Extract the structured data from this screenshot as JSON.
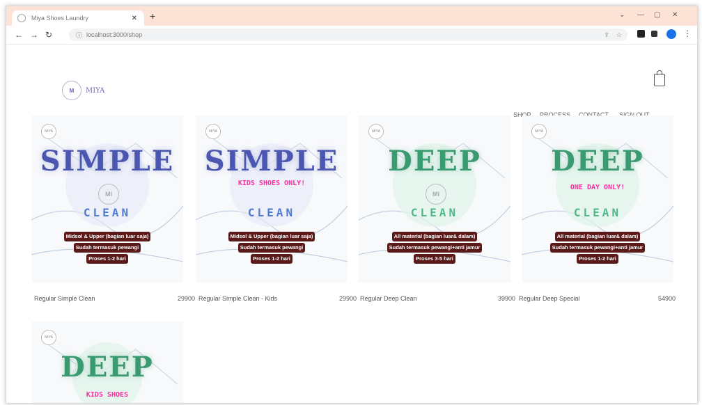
{
  "browser": {
    "tab_title": "Miya Shoes Laundry",
    "new_tab": "+",
    "url": "localhost:3000/shop",
    "controls": {
      "minimize": "—",
      "maximize": "▢",
      "close": "✕",
      "collapse": "⌄"
    }
  },
  "site": {
    "logo_badge": "M",
    "logo_name": "MIYA",
    "nav": [
      "SHOP",
      "PROCESS",
      "CONTACT",
      "SIGN OUT"
    ]
  },
  "products": [
    {
      "word": "SIMPLE",
      "sub": "CLEAN",
      "word_color": "#4a56b0",
      "sub_color": "#4f7ad0",
      "pink": "",
      "desc": [
        "Midsol & Upper (bagian luar saja)",
        "Sudah termasuk pewangi",
        "Proses 1-2 hari"
      ],
      "name": "Regular Simple Clean",
      "price": "29900"
    },
    {
      "word": "SIMPLE",
      "sub": "CLEAN",
      "word_color": "#4a56b0",
      "sub_color": "#4f7ad0",
      "pink": "KIDS SHOES ONLY!",
      "desc": [
        "Midsol & Upper (bagian luar saja)",
        "Sudah termasuk pewangi",
        "Proses 1-2 hari"
      ],
      "name": "Regular Simple Clean - Kids",
      "price": "29900"
    },
    {
      "word": "DEEP",
      "sub": "CLEAN",
      "word_color": "#3a9a70",
      "sub_color": "#4fb886",
      "pink": "",
      "desc": [
        "All material (bagian luar& dalam)",
        "Sudah termasuk pewangi+anti jamur",
        "Proses 3-5 hari"
      ],
      "name": "Regular Deep Clean",
      "price": "39900"
    },
    {
      "word": "DEEP",
      "sub": "CLEAN",
      "word_color": "#3a9a70",
      "sub_color": "#4fb886",
      "pink": "ONE DAY ONLY!",
      "desc": [
        "All material (bagian luar& dalam)",
        "Sudah termasuk pewangi+anti jamur",
        "Proses 1-2 hari"
      ],
      "name": "Regular Deep Special",
      "price": "54900"
    },
    {
      "word": "DEEP",
      "sub": "",
      "word_color": "#3a9a70",
      "sub_color": "#4fb886",
      "pink": "KIDS SHOES",
      "desc": [],
      "name": "",
      "price": ""
    }
  ]
}
